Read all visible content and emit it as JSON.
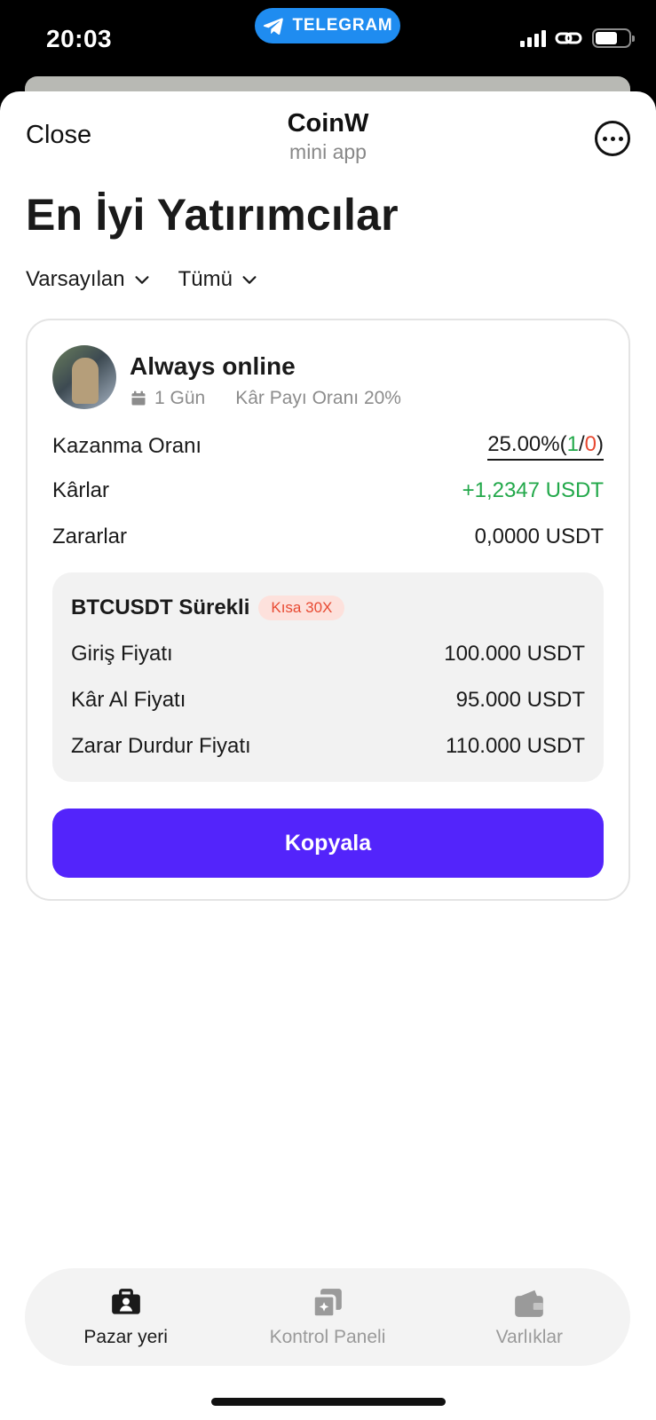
{
  "status_bar": {
    "time": "20:03",
    "pill_label": "TELEGRAM"
  },
  "header": {
    "close_label": "Close",
    "title": "CoinW",
    "subtitle": "mini app"
  },
  "page_title": "En İyi Yatırımcılar",
  "filters": [
    {
      "label": "Varsayılan"
    },
    {
      "label": "Tümü"
    }
  ],
  "trader": {
    "name": "Always online",
    "duration": "1 Gün",
    "profit_share": "Kâr Payı Oranı 20%",
    "stats": {
      "win_rate_label": "Kazanma Oranı",
      "win_rate_value": "25.00%",
      "win_rate_open": "(",
      "win_count": "1",
      "slash": "/",
      "loss_count": "0",
      "win_rate_close": ")",
      "profits_label": "Kârlar",
      "profits_value": "+1,2347 USDT",
      "losses_label": "Zararlar",
      "losses_value": "0,0000 USDT"
    },
    "position": {
      "symbol": "BTCUSDT Sürekli",
      "badge": "Kısa 30X",
      "entry_label": "Giriş Fiyatı",
      "entry_value": "100.000 USDT",
      "tp_label": "Kâr Al Fiyatı",
      "tp_value": "95.000 USDT",
      "sl_label": "Zarar Durdur Fiyatı",
      "sl_value": "110.000 USDT"
    },
    "copy_label": "Kopyala"
  },
  "bottom_nav": [
    {
      "label": "Pazar yeri",
      "active": true
    },
    {
      "label": "Kontrol Paneli",
      "active": false
    },
    {
      "label": "Varlıklar",
      "active": false
    }
  ],
  "colors": {
    "accent": "#5324fb",
    "profit_green": "#22a84a",
    "loss_red": "#e84a32",
    "telegram_blue": "#1f8cf0"
  }
}
